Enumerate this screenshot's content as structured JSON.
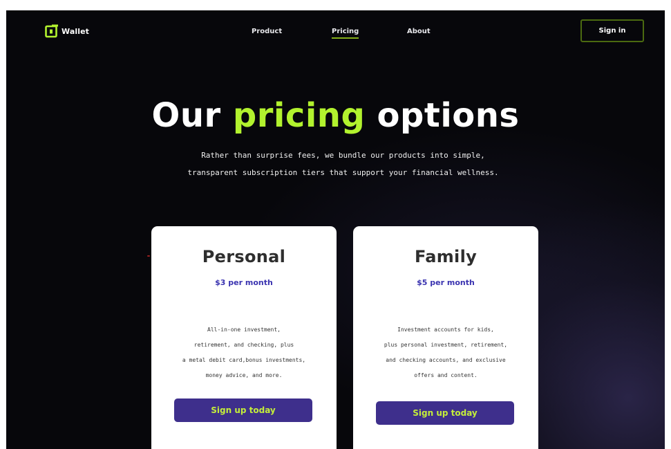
{
  "brand": {
    "name": "Wallet",
    "logo_icon": "wallet-logo-icon",
    "accent_color": "#b2f22e"
  },
  "nav": {
    "items": [
      {
        "label": "Product"
      },
      {
        "label": "Pricing"
      },
      {
        "label": "About"
      }
    ],
    "active": "Pricing",
    "signin_label": "Sign in"
  },
  "hero": {
    "title_part1": "Our",
    "title_accent": "pricing",
    "title_part2": "options",
    "subtitle_line1": "Rather than surprise fees, we bundle our products into simple,",
    "subtitle_line2": "transparent subscription tiers that support your financial wellness."
  },
  "plans": [
    {
      "name": "Personal",
      "price": "$3 per month",
      "description": [
        "All-in-one investment,",
        "retirement, and checking, plus",
        "a metal debit card,bonus investments,",
        "money advice, and more."
      ],
      "cta": "Sign up today"
    },
    {
      "name": "Family",
      "price": "$5 per month",
      "description": [
        "Investment accounts for kids,",
        "plus personal investment, retirement,",
        "and checking accounts, and exclusive",
        "offers and content."
      ],
      "cta": "Sign up today"
    }
  ],
  "colors": {
    "background": "#07070b",
    "price_text": "#3a33b0",
    "button_bg": "#3e2f8c",
    "button_text": "#c4ee3a"
  }
}
